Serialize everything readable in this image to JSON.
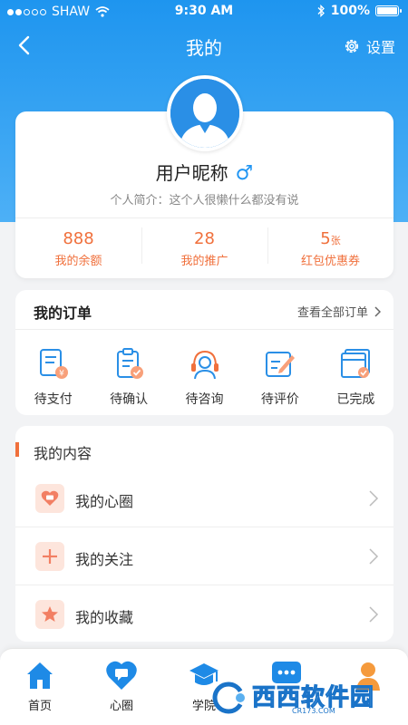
{
  "status_bar": {
    "carrier": "SHAW",
    "time": "9:30 AM",
    "battery": "100%",
    "battery_level": 1.0
  },
  "nav": {
    "title": "我的",
    "settings_label": "设置"
  },
  "profile": {
    "nickname": "用户昵称",
    "gender_symbol": "♂",
    "intro": "个人简介：这个人很懒什么都没有说",
    "stats": [
      {
        "value": "888",
        "unit": "",
        "label": "我的余额"
      },
      {
        "value": "28",
        "unit": "",
        "label": "我的推广"
      },
      {
        "value": "5",
        "unit": "张",
        "label": "红包优惠券"
      }
    ]
  },
  "orders": {
    "title": "我的订单",
    "view_all": "查看全部订单",
    "items": [
      {
        "label": "待支付",
        "icon": "bill-icon"
      },
      {
        "label": "待确认",
        "icon": "clipboard-check-icon"
      },
      {
        "label": "待咨询",
        "icon": "headset-icon"
      },
      {
        "label": "待评价",
        "icon": "edit-icon"
      },
      {
        "label": "已完成",
        "icon": "completed-icon"
      }
    ]
  },
  "content": {
    "title": "我的内容",
    "rows": [
      {
        "label": "我的心圈",
        "icon": "heart-chat-icon"
      },
      {
        "label": "我的关注",
        "icon": "plus-icon"
      },
      {
        "label": "我的收藏",
        "icon": "star-icon"
      }
    ]
  },
  "tabbar": {
    "tabs": [
      {
        "label": "首页",
        "icon": "home-icon"
      },
      {
        "label": "心圈",
        "icon": "heart-chat-icon"
      },
      {
        "label": "学院",
        "icon": "graduation-cap-icon"
      },
      {
        "label": "",
        "icon": "message-icon"
      },
      {
        "label": "",
        "icon": "user-icon"
      }
    ]
  },
  "watermark": {
    "text": "西西软件园",
    "sub": "CR173.COM"
  },
  "colors": {
    "primary_blue": "#1e95ef",
    "accent_orange": "#f0703c",
    "background": "#f2f3f5"
  }
}
